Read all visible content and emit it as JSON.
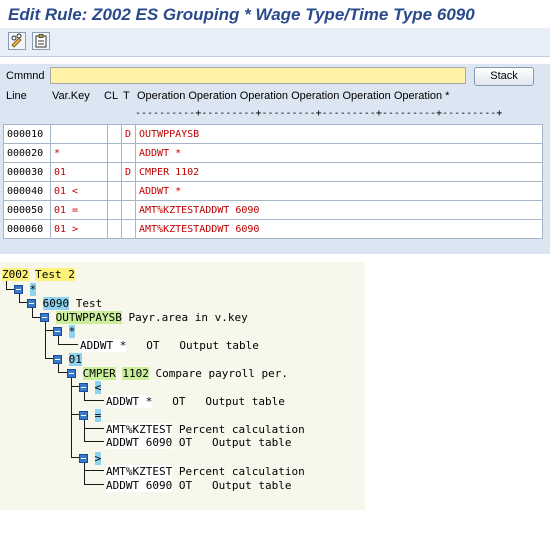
{
  "window": {
    "title": "Edit Rule: Z002 ES Grouping * Wage Type/Time Type 6090"
  },
  "toolbar": {
    "buttons": [
      {
        "icon": "pencil-glasses-icon"
      },
      {
        "icon": "clipboard-icon"
      }
    ]
  },
  "command": {
    "label": "Cmmnd",
    "value": "",
    "stack_label": "Stack"
  },
  "table": {
    "headers": {
      "line": "Line",
      "varkey": "Var.Key",
      "cl": "CL",
      "t": "T",
      "operation": "Operation Operation Operation Operation Operation Operation *"
    },
    "ruler": "----------+---------+---------+---------+---------+---------+",
    "rows": [
      {
        "line": "000010",
        "varkey": "",
        "cl": "",
        "t": "D",
        "op": "OUTWPPAYSB"
      },
      {
        "line": "000020",
        "varkey": "*",
        "cl": "",
        "t": "",
        "op": "ADDWT *"
      },
      {
        "line": "000030",
        "varkey": "01",
        "cl": "",
        "t": "D",
        "op": "CMPER 1102"
      },
      {
        "line": "000040",
        "varkey": "01 <",
        "cl": "",
        "t": "",
        "op": "ADDWT *"
      },
      {
        "line": "000050",
        "varkey": "01 =",
        "cl": "",
        "t": "",
        "op": "AMT%KZTESTADDWT 6090"
      },
      {
        "line": "000060",
        "varkey": "01 >",
        "cl": "",
        "t": "",
        "op": "AMT%KZTESTADDWT 6090"
      }
    ]
  },
  "tree": {
    "root_code": "Z002",
    "root_text": "Test 2",
    "n1": "*",
    "n2_code": "6090",
    "n2_text": "Test",
    "n3_code": "OUTWPPAYSB",
    "n3_text": "Payr.area in v.key",
    "n4": "*",
    "n5_code": "ADDWT *",
    "n5_type": "OT",
    "n5_text": "Output table",
    "n6": "01",
    "n7_code": "CMPER",
    "n7_param": "1102",
    "n7_text": "Compare payroll per.",
    "n8": "<",
    "n9_code": "ADDWT *",
    "n9_type": "OT",
    "n9_text": "Output table",
    "n10": "=",
    "n11_code": "AMT%KZTEST",
    "n11_text": "Percent calculation",
    "n12_code": "ADDWT 6090",
    "n12_type": "OT",
    "n12_text": "Output table",
    "n13": ">",
    "n14_code": "AMT%KZTEST",
    "n14_text": "Percent calculation",
    "n15_code": "ADDWT 6090",
    "n15_type": "OT",
    "n15_text": "Output table"
  }
}
